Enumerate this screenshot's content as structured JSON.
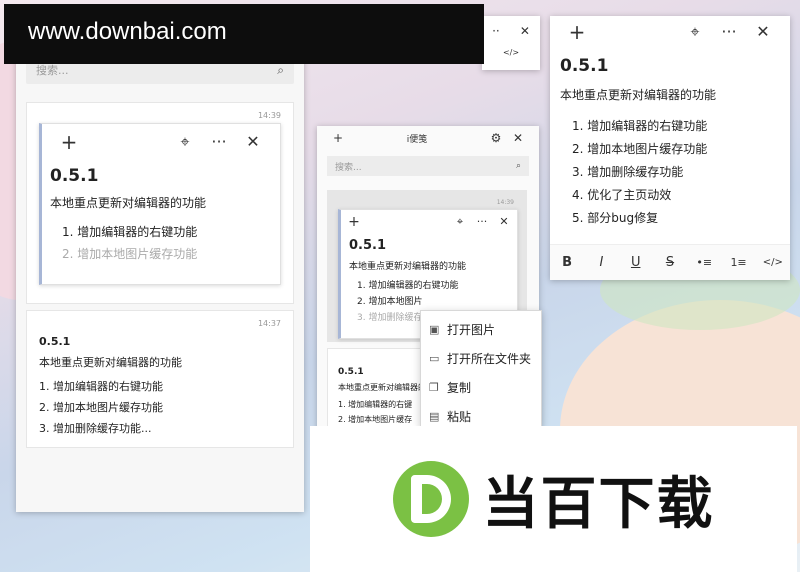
{
  "watermark": {
    "text": "www.downbai.com"
  },
  "list_window": {
    "search_placeholder": "搜索...",
    "card1": {
      "time": "14:39",
      "heading": "0.5.1",
      "summary": "本地重点更新对编辑器的功能",
      "items": [
        "1. 增加编辑器的右键功能",
        "2. 增加本地图片缓存功能"
      ]
    },
    "card2": {
      "time": "14:37",
      "heading": "0.5.1",
      "summary": "本地重点更新对编辑器的功能",
      "items": [
        "1.  增加编辑器的右键功能",
        "2.  增加本地图片缓存功能",
        "3.  增加删除缓存功能..."
      ]
    }
  },
  "mid_window": {
    "title": "i便笺",
    "search_placeholder": "搜索...",
    "card1": {
      "time": "14:39",
      "heading": "0.5.1",
      "summary": "本地重点更新对编辑器的功能",
      "items": [
        "1. 增加编辑器的右键功能",
        "2. 增加本地图片",
        "3. 增加删除缓存"
      ]
    },
    "card2": {
      "heading": "0.5.1",
      "summary": "本地重点更新对编辑器的",
      "items": [
        "1.  增加编辑器的右键",
        "2.  增加本地图片缓存"
      ]
    }
  },
  "context_menu": {
    "items": [
      "打开图片",
      "打开所在文件夹",
      "复制",
      "粘贴"
    ]
  },
  "editor": {
    "heading": "0.5.1",
    "summary": "本地重点更新对编辑器的功能",
    "items": [
      "1. 增加编辑器的右键功能",
      "2. 增加本地图片缓存功能",
      "3. 增加删除缓存功能",
      "4. 优化了主页动效",
      "5. 部分bug修复"
    ],
    "toolbar": [
      "B",
      "I",
      "U",
      "S",
      "•≡",
      "1≡",
      "</>"
    ]
  },
  "icons": {
    "add": "+",
    "pin": "pin-icon",
    "more": "···",
    "close": "✕",
    "search": "⌕",
    "gear": "⚙"
  },
  "logo": {
    "text": "当百下载",
    "mark_letter": "D",
    "accent": "#7bc144"
  }
}
